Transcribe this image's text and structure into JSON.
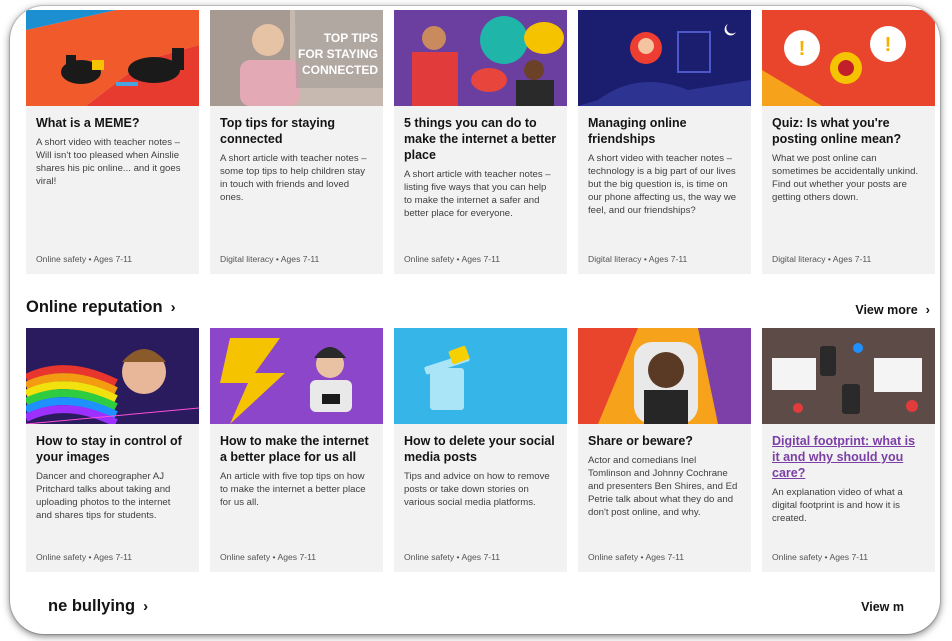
{
  "top_cards": [
    {
      "title": "What is a MEME?",
      "desc": "A short video with teacher notes – Will isn't too pleased when Ainslie shares his pic online... and it goes viral!",
      "meta": "Online safety • Ages 7-11"
    },
    {
      "title": "Top tips for staying connected",
      "desc": "A short article with teacher notes – some top tips to help children stay in touch with friends and loved ones.",
      "meta": "Digital literacy • Ages 7-11",
      "image_text": "TOP TIPS FOR STAYING CONNECTED"
    },
    {
      "title": "5 things you can do to make the internet a better place",
      "desc": "A short article with teacher notes – listing five ways that you can help to make the internet a safer and better place for everyone.",
      "meta": "Online safety • Ages 7-11"
    },
    {
      "title": "Managing online friendships",
      "desc": "A short video with teacher notes – technology is a big part of our lives but the big question is, is time on our phone affecting us, the way we feel, and our friendships?",
      "meta": "Digital literacy • Ages 7-11"
    },
    {
      "title": "Quiz: Is what you're posting online mean?",
      "desc": "What we post online can sometimes be accidentally unkind. Find out whether your posts are getting others down.",
      "meta": "Digital literacy • Ages 7-11"
    }
  ],
  "section1": {
    "title": "Online reputation",
    "view_more": "View more"
  },
  "mid_cards": [
    {
      "title": "How to stay in control of your images",
      "desc": "Dancer and choreographer AJ Pritchard talks about taking and uploading photos to the internet and shares tips for students.",
      "meta": "Online safety • Ages 7-11"
    },
    {
      "title": "How to make the internet a better place for us all",
      "desc": "An article with five top tips on how to make the internet a better place for us all.",
      "meta": "Online safety • Ages 7-11"
    },
    {
      "title": "How to delete your social media posts",
      "desc": "Tips and advice on how to remove posts or take down stories on various social media platforms.",
      "meta": "Online safety • Ages 7-11"
    },
    {
      "title": "Share or beware?",
      "desc": "Actor and comedians Inel Tomlinson and Johnny Cochrane and presenters Ben Shires, and Ed Petrie talk about what they do and don't post online, and why.",
      "meta": "Online safety • Ages 7-11"
    },
    {
      "title": "Digital footprint: what is it and why should you care?",
      "desc": "An explanation video of what a digital footprint is and how it is created.",
      "meta": "Online safety • Ages 7-11"
    }
  ],
  "section2": {
    "title": "ne bullying",
    "view_more": "View m"
  },
  "colors": {
    "link": "#7b3fa6",
    "card_bg": "#f2f2f2"
  },
  "icons": {
    "chevron": "chevron-right-icon"
  }
}
